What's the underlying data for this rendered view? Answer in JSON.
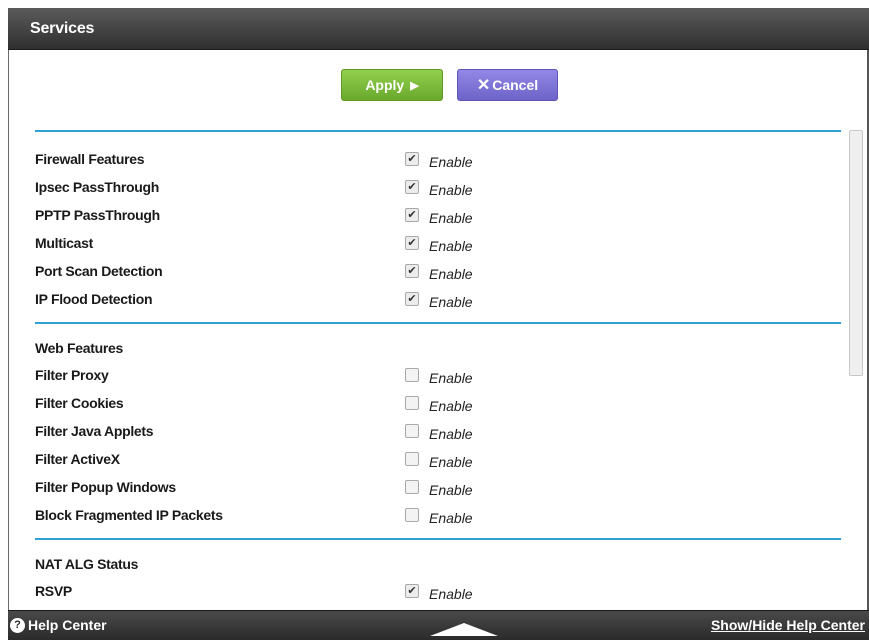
{
  "header": {
    "title": "Services"
  },
  "actions": {
    "apply_label": "Apply",
    "apply_glyph": "▶",
    "cancel_glyph": "✕",
    "cancel_label": "Cancel"
  },
  "firewall": {
    "rows": [
      {
        "label": "Firewall Features",
        "enable": "Enable",
        "checked": true
      },
      {
        "label": "Ipsec PassThrough",
        "enable": "Enable",
        "checked": true
      },
      {
        "label": "PPTP PassThrough",
        "enable": "Enable",
        "checked": true
      },
      {
        "label": "Multicast",
        "enable": "Enable",
        "checked": true
      },
      {
        "label": "Port Scan Detection",
        "enable": "Enable",
        "checked": true
      },
      {
        "label": "IP Flood Detection",
        "enable": "Enable",
        "checked": true
      }
    ]
  },
  "web": {
    "heading": "Web Features",
    "rows": [
      {
        "label": "Filter Proxy",
        "enable": "Enable",
        "checked": false
      },
      {
        "label": "Filter Cookies",
        "enable": "Enable",
        "checked": false
      },
      {
        "label": "Filter Java Applets",
        "enable": "Enable",
        "checked": false
      },
      {
        "label": "Filter ActiveX",
        "enable": "Enable",
        "checked": false
      },
      {
        "label": "Filter Popup Windows",
        "enable": "Enable",
        "checked": false
      },
      {
        "label": "Block Fragmented IP Packets",
        "enable": "Enable",
        "checked": false
      }
    ]
  },
  "nat": {
    "heading": "NAT ALG Status",
    "rows": [
      {
        "label": "RSVP",
        "enable": "Enable",
        "checked": true
      }
    ]
  },
  "footer": {
    "help_center": "Help Center",
    "help_icon": "?",
    "show_hide": "Show/Hide Help Center"
  },
  "colors": {
    "accent_divider": "#2f9fd3",
    "apply": "#7fbd3f",
    "cancel": "#7b72d6"
  }
}
